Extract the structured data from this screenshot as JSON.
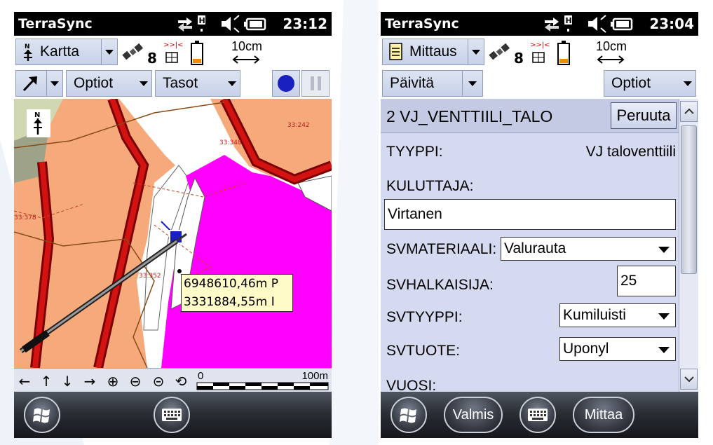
{
  "left_screen": {
    "status": {
      "app_title": "TerraSync",
      "time": "23:12"
    },
    "toolbar": {
      "section_label": "Kartta",
      "satellite_count": "8",
      "precision": "10cm"
    },
    "map_toolbar": {
      "options_label": "Optiot",
      "layers_label": "Tasot"
    },
    "map": {
      "parcel_labels": [
        "33:242",
        "33:348",
        "33:378",
        "33:352"
      ],
      "coord_north": "6948610,46m P",
      "coord_east": "3331884,55m I"
    },
    "scale": {
      "start": "0",
      "end": "100m"
    }
  },
  "right_screen": {
    "status": {
      "app_title": "TerraSync",
      "time": "23:04"
    },
    "toolbar": {
      "section_label": "Mittaus",
      "satellite_count": "8",
      "precision": "10cm"
    },
    "form_toolbar": {
      "update_label": "Päivitä",
      "options_label": "Optiot"
    },
    "form": {
      "title": "2 VJ_VENTTIILI_TALO",
      "cancel_label": "Peruuta",
      "fields": {
        "tyyppi": {
          "label": "TYYPPI:",
          "value": "VJ taloventtiili"
        },
        "kuluttaja": {
          "label": "KULUTTAJA:",
          "value": "Virtanen"
        },
        "svmateriaali": {
          "label": "SVMATERIAALI:",
          "value": "Valurauta"
        },
        "svhalkaisija": {
          "label": "SVHALKAISIJA:",
          "value": "25"
        },
        "svtyyppi": {
          "label": "SVTYYPPI:",
          "value": "Kumiluisti"
        },
        "svtuote": {
          "label": "SVTUOTE:",
          "value": "Uponyl"
        },
        "vuosi": {
          "label": "VUOSI:"
        }
      }
    },
    "dock": {
      "done_label": "Valmis",
      "measure_label": "Mittaa"
    }
  },
  "colors": {
    "status_bg": "#000000",
    "toolbar_button": "#cdd5ea",
    "form_bg": "#d6daf0",
    "map_orange": "#f6a97b",
    "map_magenta": "#ff00ff",
    "road_red": "#c81414",
    "gps_dot": "#1a1fbf"
  },
  "icons": [
    "north-arrow-icon",
    "satellite-icon",
    "antenna-icon",
    "battery-icon",
    "precision-arrow-icon",
    "pan-tool-icon",
    "record-icon",
    "pause-icon",
    "windows-start-icon",
    "keyboard-icon",
    "notepad-icon",
    "arrow-left-icon",
    "arrow-up-icon",
    "arrow-down-icon",
    "arrow-right-icon",
    "zoom-in-icon",
    "zoom-out-icon",
    "zoom-extent-icon",
    "zoom-previous-icon"
  ]
}
